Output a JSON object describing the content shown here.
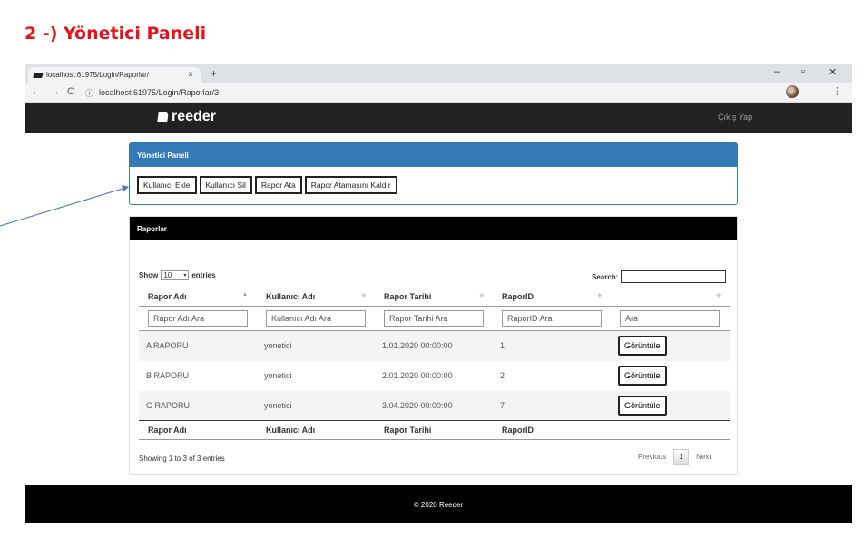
{
  "doc_heading": "2 -) Yönetici Paneli",
  "browser": {
    "tab_title": "localhost:61975/Login/Raporlar/",
    "tab_close": "×",
    "new_tab": "+",
    "url": "localhost:61975/Login/Raporlar/3",
    "win_min": "–",
    "win_max": "▫",
    "win_close": "✕",
    "back": "←",
    "forward": "→",
    "reload": "C",
    "info": "ⓘ",
    "star": "☆",
    "menu": "⋮"
  },
  "site": {
    "brand": "reeder",
    "logout": "Çıkış Yap",
    "footer": "© 2020 Reeder"
  },
  "admin_panel": {
    "title": "Yönetici Paneli",
    "buttons": [
      "Kullanıcı Ekle",
      "Kullanıcı Sil",
      "Rapor Ata",
      "Rapor Atamasını Kaldır"
    ]
  },
  "reports": {
    "title": "Raporlar",
    "show_label": "Show",
    "entries_value": "10",
    "entries_label": "entries",
    "search_label": "Search:",
    "columns": [
      "Rapor Adı",
      "Kullanıcı Adı",
      "Rapor Tarihi",
      "RaporID",
      ""
    ],
    "filters": [
      "Rapor Adı Ara",
      "Kullanıcı Adı Ara",
      "Rapor Tarihi Ara",
      "RaporID Ara",
      "Ara"
    ],
    "rows": [
      {
        "name": "A RAPORU",
        "user": "yonetici",
        "date": "1.01.2020 00:00:00",
        "id": "1",
        "action": "Görüntüle"
      },
      {
        "name": "B RAPORU",
        "user": "yonetici",
        "date": "2.01.2020 00:00:00",
        "id": "2",
        "action": "Görüntüle"
      },
      {
        "name": "G RAPORU",
        "user": "yonetici",
        "date": "3.04.2020 00:00:00",
        "id": "7",
        "action": "Görüntüle"
      }
    ],
    "info": "Showing 1 to 3 of 3 entries",
    "previous": "Previous",
    "page": "1",
    "next": "Next"
  }
}
